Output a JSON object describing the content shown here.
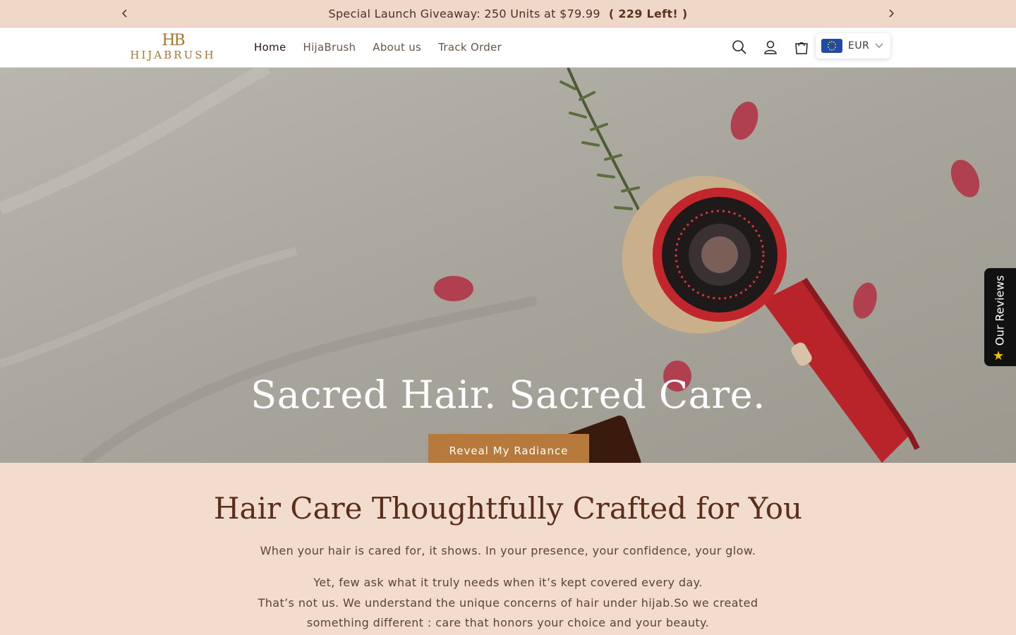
{
  "announcement": {
    "message": "Special Launch Giveaway: 250 Units at $79.99",
    "highlight": "( 229 Left! )",
    "prev_icon": "chevron-left-icon",
    "next_icon": "chevron-right-icon"
  },
  "header": {
    "logo_monogram": "HB",
    "logo_text": "HIJABRUSH",
    "nav": [
      {
        "label": "Home"
      },
      {
        "label": "HijaBrush"
      },
      {
        "label": "About us"
      },
      {
        "label": "Track Order"
      }
    ],
    "icons": [
      "search-icon",
      "account-icon",
      "cart-icon"
    ],
    "currency": {
      "code": "EUR",
      "flag": "eu-flag-icon"
    }
  },
  "hero": {
    "title": "Sacred Hair. Sacred Care.",
    "cta": "Reveal My Radiance"
  },
  "reviews_tab": {
    "label": "Our Reviews",
    "icon": "star-icon"
  },
  "intro": {
    "heading": "Hair Care Thoughtfully Crafted for You",
    "line1": "When your hair is cared for, it shows. In your presence, your confidence, your glow.",
    "line2": "Yet, few ask what it truly needs when it’s kept covered every day.",
    "line3": "That’s not us. We understand the unique concerns of hair under hijab.So we created",
    "line4": "something different : care that honors your choice and your beauty."
  },
  "colors": {
    "accent": "#b87a3c",
    "announcement_bg": "#f0d8c8",
    "heading": "#5b2e1c"
  }
}
